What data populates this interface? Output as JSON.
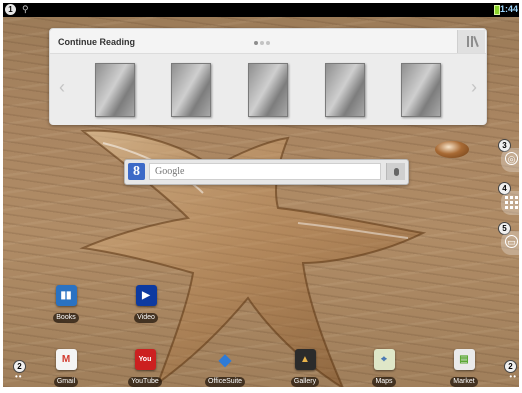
{
  "status_bar": {
    "badge": "1",
    "time": "1:44"
  },
  "continue_reading": {
    "title": "Continue Reading",
    "page_dots": 3,
    "active_dot": 1,
    "left_arrow": "‹",
    "right_arrow": "›",
    "book_count": 5
  },
  "search": {
    "logo": "8",
    "placeholder": "Google"
  },
  "side_buttons": [
    {
      "badge": "3",
      "icon": "globe-icon",
      "glyph": "◎"
    },
    {
      "badge": "4",
      "icon": "all-apps-grid-icon",
      "glyph": ""
    },
    {
      "badge": "5",
      "icon": "folder-icon",
      "glyph": "▭"
    }
  ],
  "home_apps": [
    {
      "label": "Books",
      "icon": "books-icon",
      "glyph": "▮▮",
      "color": "#2a72c2"
    },
    {
      "label": "Video",
      "icon": "video-icon",
      "glyph": "▶",
      "color": "#0d3aa0"
    }
  ],
  "dock": {
    "left_badge": "2",
    "right_badge": "2",
    "page_indicator": "••",
    "apps": [
      {
        "label": "Gmail",
        "icon": "gmail-icon",
        "glyph": "M",
        "color": "#d23a2e"
      },
      {
        "label": "YouTube",
        "icon": "youtube-icon",
        "glyph": "You",
        "color": "#cc2020"
      },
      {
        "label": "OfficeSuite",
        "icon": "officesuite-icon",
        "glyph": "◆",
        "color": "#3a8d3a"
      },
      {
        "label": "Gallery",
        "icon": "gallery-icon",
        "glyph": "▲",
        "color": "#c7831b"
      },
      {
        "label": "Maps",
        "icon": "maps-icon",
        "glyph": "⌖",
        "color": "#6aa84f"
      },
      {
        "label": "Market",
        "icon": "market-icon",
        "glyph": "▤",
        "color": "#5aa832"
      }
    ]
  }
}
